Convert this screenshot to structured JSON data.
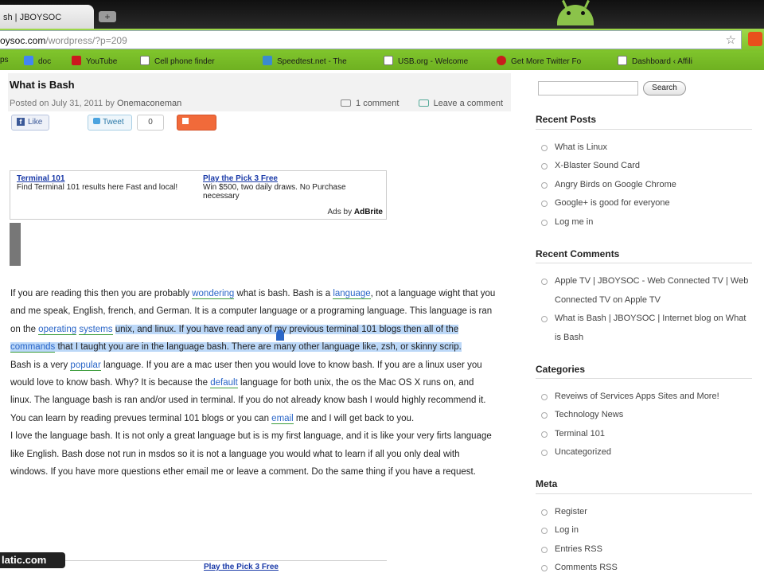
{
  "browser": {
    "tab_title": "sh | JBOYSOC",
    "new_tab_symbol": "+",
    "url_domain": "oysoc.com",
    "url_path": "/wordpress/?p=209",
    "star_symbol": "☆"
  },
  "bookmarks": [
    {
      "label": "ps",
      "color": "#d0d0d0"
    },
    {
      "label": "doc",
      "color": "#4285f4"
    },
    {
      "label": "YouTube",
      "color": "#cc181e"
    },
    {
      "label": "Cell phone finder",
      "color": "#ffffff"
    },
    {
      "label": "Speedtest.net - The",
      "color": "#3b8bd0"
    },
    {
      "label": "USB.org - Welcome",
      "color": "#ffffff"
    },
    {
      "label": "Get More Twitter Fo",
      "color": "#c81c1c"
    },
    {
      "label": "Dashboard ‹ Affili",
      "color": "#ffffff"
    }
  ],
  "post": {
    "title": "What is Bash",
    "posted_on": "Posted on July 31, 2011 by",
    "author": "Onemaconeman",
    "comment_count": "1 comment",
    "leave_comment": "Leave a comment"
  },
  "share": {
    "like": "Like",
    "tweet": "Tweet",
    "count": "0",
    "share": "Share"
  },
  "ads": {
    "ad1_title": "Terminal 101",
    "ad1_text": "Find Terminal 101 results here Fast and local!",
    "ad2_title": "Play the Pick 3 Free",
    "ad2_text": "Win $500, two daily draws. No Purchase necessary",
    "ads_by_prefix": "Ads by",
    "ads_by_brand": "AdBrite",
    "bottom_link": "Play the Pick 3 Free"
  },
  "article": {
    "p1": {
      "a": "If you are reading this then you are probably ",
      "k1": "wondering",
      "b": " what is bash. Bash is a ",
      "k2": "language",
      "c": ", not a language wight that you and me speak, English, french, and German. It is a computer language or a programing language. This language is ran on the ",
      "k3": "operating",
      "d": " ",
      "k4": "systems",
      "e": " ",
      "sel1": "unix, and linux. If you have read any of my previous terminal 101 blogs then all of the ",
      "k5": "commands",
      "sel2": " that I taught you are in the language bash. There are many other language like, zsh, or skinny scrip."
    },
    "p2": {
      "a": "Bash is a very ",
      "k1": "popular",
      "b": " language. If you are a mac user then you would love to know bash. If you are a linux user you would love to know bash. Why? It is because the ",
      "k2": "default",
      "c": " language for both unix, the os the Mac OS X runs on, and linux. The language bash is ran and/or used in terminal. If you do not already know bash I would highly recommend it. You can learn by reading prevues terminal 101 blogs or you can ",
      "k3": "email",
      "d": " me and I will get back to you."
    },
    "p3": "I love the language bash. It is not only a great language but is is my first language, and it is like your very firts language like English. Bash dose not run in msdos so it is not a language you would what to learn if all you only deal with windows. If you have more questions ether email me or leave a comment. Do the same thing if you have a request."
  },
  "watermark": "latic.com",
  "sidebar": {
    "search_button": "Search",
    "recent_posts_title": "Recent Posts",
    "recent_posts": [
      "What is Linux",
      "X-Blaster Sound Card",
      "Angry Birds on Google Chrome",
      "Google+ is good for everyone",
      "Log me in"
    ],
    "recent_comments_title": "Recent Comments",
    "recent_comments": [
      "Apple TV | JBOYSOC - Web Connected TV | Web Connected TV on Apple TV",
      "What is Bash | JBOYSOC | Internet blog on What is Bash"
    ],
    "categories_title": "Categories",
    "categories": [
      "Reveiws of Services Apps Sites and More!",
      "Technology News",
      "Terminal 101",
      "Uncategorized"
    ],
    "meta_title": "Meta",
    "meta": [
      "Register",
      "Log in",
      "Entries RSS",
      "Comments RSS"
    ]
  }
}
